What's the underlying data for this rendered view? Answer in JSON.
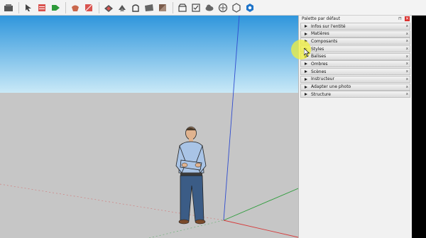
{
  "toolbar": {
    "icons": [
      "camera-icon",
      "select-icon",
      "erase-icon",
      "paint-icon",
      "rectangle-icon",
      "push-pull-icon",
      "follow-me-icon",
      "offset-icon",
      "move-icon",
      "rotate-icon",
      "scale-icon",
      "tape-icon",
      "dimension-icon",
      "section-icon",
      "warehouse-icon",
      "extension-icon",
      "layout-icon",
      "cloud-icon",
      "component-icon",
      "sync-icon",
      "help-icon"
    ]
  },
  "tray": {
    "title": "Palette par défaut",
    "pin_glyph": "⊓",
    "close_glyph": "✕",
    "panels": [
      {
        "label": "Infos sur l'entité"
      },
      {
        "label": "Matières"
      },
      {
        "label": "Composants"
      },
      {
        "label": "Styles"
      },
      {
        "label": "Balises"
      },
      {
        "label": "Ombres"
      },
      {
        "label": "Scènes"
      },
      {
        "label": "Instructeur"
      },
      {
        "label": "Adapter une photo"
      },
      {
        "label": "Structure"
      }
    ],
    "panel_close_glyph": "x"
  },
  "colors": {
    "sky_top": "#2f96dc",
    "sky_bottom": "#c9e9f7",
    "ground": "#c6c6c6",
    "axis_blue": "#2f4ccf",
    "axis_red": "#d63a3a",
    "axis_green": "#2c9c3a",
    "highlight": "#f0f03c"
  }
}
